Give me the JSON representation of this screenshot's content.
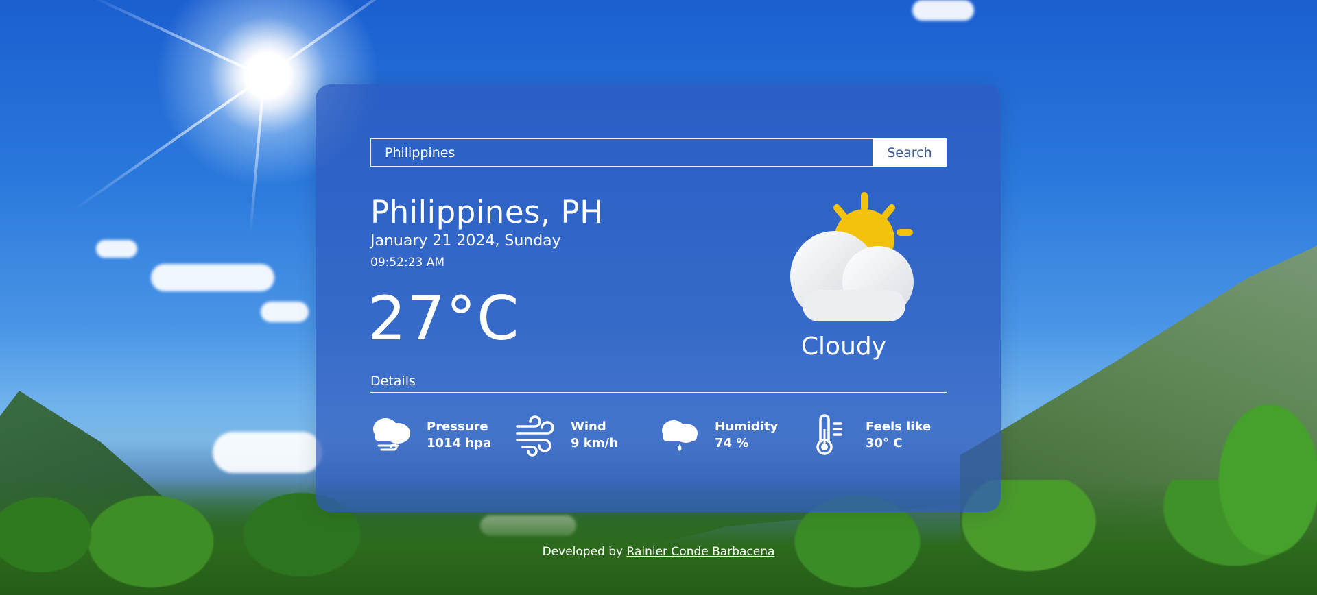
{
  "search": {
    "value": "Philippines",
    "button_label": "Search"
  },
  "weather": {
    "location": "Philippines, PH",
    "date": "January 21 2024, Sunday",
    "time": "09:52:23 AM",
    "temperature": "27°C",
    "condition": "Cloudy",
    "icon": "sun-behind-cloud-icon"
  },
  "details": {
    "title": "Details",
    "items": [
      {
        "label": "Pressure",
        "value": "1014 hpa",
        "icon": "pressure-cloud-icon"
      },
      {
        "label": "Wind",
        "value": "9 km/h",
        "icon": "wind-icon"
      },
      {
        "label": "Humidity",
        "value": "74 %",
        "icon": "humidity-icon"
      },
      {
        "label": "Feels like",
        "value": "30° C",
        "icon": "thermometer-icon"
      }
    ]
  },
  "footer": {
    "prefix": "Developed by",
    "author": "Rainier Conde Barbacena"
  },
  "colors": {
    "card": "#2f5abe",
    "sun": "#f2c20c",
    "button_text": "#3b5a9a"
  }
}
